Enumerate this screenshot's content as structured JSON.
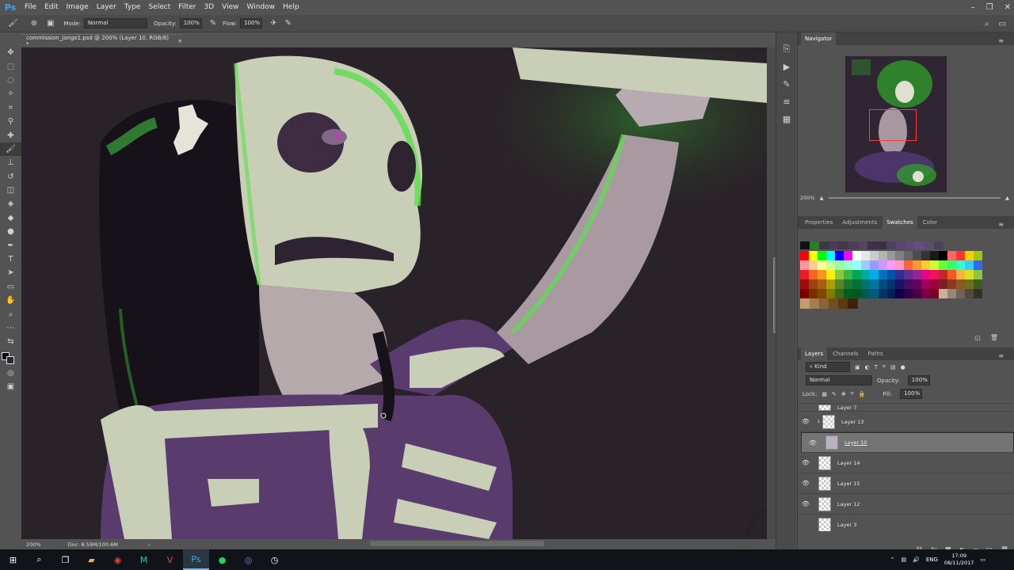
{
  "app": {
    "logo": "Ps"
  },
  "menu": [
    "File",
    "Edit",
    "Image",
    "Layer",
    "Type",
    "Select",
    "Filter",
    "3D",
    "View",
    "Window",
    "Help"
  ],
  "options": {
    "mode_label": "Mode:",
    "mode_value": "Normal",
    "opacity_label": "Opacity:",
    "opacity_value": "100%",
    "flow_label": "Flow:",
    "flow_value": "100%"
  },
  "document": {
    "tab_title": "commission_jango1.psd @ 200% (Layer 10, RGB/8) *",
    "close": "×"
  },
  "status": {
    "zoom": "200%",
    "doc_info": "Doc: 8.59M/100.6M",
    "arrow": "›"
  },
  "navigator": {
    "tab": "Navigator",
    "zoom": "200%"
  },
  "swatches_tabs": [
    "Properties",
    "Adjustments",
    "Swatches",
    "Color"
  ],
  "swatches_active": "Swatches",
  "swatch_colors": [
    [
      "#111111",
      "#2a7d2a",
      "#3a3a3a",
      "#4b3a55",
      "#44354d",
      "#4d3d59",
      "#554563",
      "#3d3048",
      "#3b2f45",
      "#4e3e60",
      "#5a4770",
      "#604a78",
      "#664f80",
      "#5a4d6b",
      "#4d4158"
    ],
    [
      "#ff0000",
      "#ffff00",
      "#00ff00",
      "#00ffff",
      "#0000ff",
      "#ff00ff",
      "#ffffff",
      "#e6e6e6",
      "#cccccc",
      "#b3b3b3",
      "#999999",
      "#808080",
      "#666666",
      "#4d4d4d",
      "#333333",
      "#1a1a1a",
      "#000000",
      "#ff6666",
      "#ff3333",
      "#ffcc00",
      "#99cc00"
    ],
    [
      "#ff9999",
      "#ffcc99",
      "#ffff99",
      "#ccff99",
      "#99ff99",
      "#99ffcc",
      "#99ffff",
      "#99ccff",
      "#9999ff",
      "#cc99ff",
      "#ff99ff",
      "#ff99cc",
      "#ff6633",
      "#ff9933",
      "#ffcc33",
      "#ccff33",
      "#66ff33",
      "#33ff66",
      "#33ffcc",
      "#33ccff",
      "#3366ff"
    ],
    [
      "#ed1c24",
      "#f26522",
      "#f7941d",
      "#fff200",
      "#8dc63f",
      "#39b54a",
      "#00a651",
      "#00a99d",
      "#00aeef",
      "#0072bc",
      "#0054a6",
      "#2e3192",
      "#662d91",
      "#92278f",
      "#ec008c",
      "#ed145b",
      "#c1272d",
      "#f15a24",
      "#fbb03b",
      "#d9e021",
      "#8cc63f"
    ],
    [
      "#9e0b0f",
      "#a0410d",
      "#a36209",
      "#aba000",
      "#598527",
      "#1a7b30",
      "#007236",
      "#00746b",
      "#0076a3",
      "#004b80",
      "#003471",
      "#1b1464",
      "#440e62",
      "#630460",
      "#9e005d",
      "#9e0039",
      "#7b1f1f",
      "#8c3a1f",
      "#8c5a1f",
      "#6e701f",
      "#3d5e1f"
    ],
    [
      "#790000",
      "#7b2e00",
      "#7d4900",
      "#827b00",
      "#406618",
      "#005e20",
      "#005826",
      "#005952",
      "#005b7f",
      "#003663",
      "#002157",
      "#0d004c",
      "#32004b",
      "#4b0049",
      "#7b0046",
      "#7a0026",
      "#c7b299",
      "#998675",
      "#736357",
      "#534741",
      "#37302a"
    ],
    [
      "#c69c6d",
      "#a67c52",
      "#8c6239",
      "#754c24",
      "#603913",
      "#42210b"
    ]
  ],
  "layers": {
    "tabs": [
      "Layers",
      "Channels",
      "Paths"
    ],
    "active_tab": "Layers",
    "kind": "Kind",
    "blend": "Normal",
    "opacity_label": "Opacity:",
    "opacity_value": "100%",
    "lock_label": "Lock:",
    "fill_label": "Fill:",
    "fill_value": "100%",
    "items": [
      {
        "name": "Layer 7",
        "visible": false
      },
      {
        "name": "Layer 13",
        "visible": true
      },
      {
        "name": "Layer 10",
        "visible": true,
        "selected": true
      },
      {
        "name": "Layer 14",
        "visible": true
      },
      {
        "name": "Layer 15",
        "visible": true
      },
      {
        "name": "Layer 12",
        "visible": true
      },
      {
        "name": "Layer 3",
        "visible": false
      }
    ]
  },
  "taskbar": {
    "lang": "ENG",
    "time": "17:09",
    "date": "08/11/2017"
  },
  "colors": {
    "accent": "#31a8ff",
    "green_glow": "#39d630",
    "skeleton_bone": "#c9cfb6",
    "dress": "#5a3b6e",
    "bg_dark": "#2a2229"
  }
}
